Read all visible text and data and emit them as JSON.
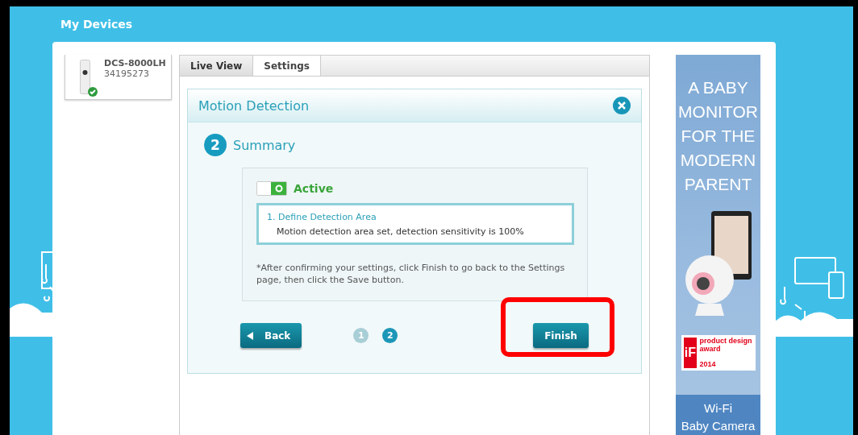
{
  "header": {
    "title": "My Devices"
  },
  "device": {
    "name": "DCS-8000LH",
    "serial": "34195273",
    "online": true
  },
  "tabs": [
    {
      "label": "Live View",
      "selected": false
    },
    {
      "label": "Settings",
      "selected": true
    }
  ],
  "dialog": {
    "title": "Motion Detection",
    "step": {
      "number": "2",
      "title": "Summary"
    },
    "toggle": {
      "label": "Active",
      "on": true
    },
    "summary": {
      "title": "1. Define Detection Area",
      "text": "Motion detection area set, detection sensitivity is 100%"
    },
    "note": "*After confirming your settings, click Finish to go back to the Settings page, then click the Save button.",
    "back_button": "Back",
    "pages": [
      {
        "label": "1",
        "selected": false
      },
      {
        "label": "2",
        "selected": true
      }
    ],
    "finish_button": "Finish",
    "finish_highlighted": true
  },
  "ad": {
    "headline": "A BABY MONITOR FOR THE MODERN PARENT",
    "award": {
      "logo": "iF",
      "label": "product design award",
      "year": "2014"
    },
    "footer": [
      "Wi-Fi",
      "Baby Camera"
    ]
  }
}
